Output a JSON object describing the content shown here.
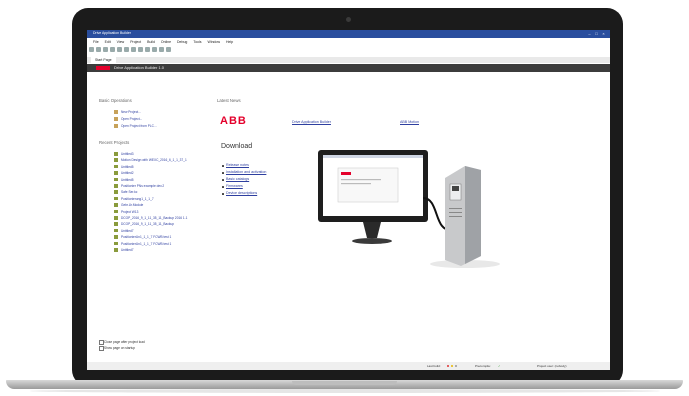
{
  "window": {
    "title": "Drive Application Builder"
  },
  "menu": [
    "File",
    "Edit",
    "View",
    "Project",
    "Build",
    "Online",
    "Debug",
    "Tools",
    "Window",
    "Help"
  ],
  "tab": {
    "label": "Start Page"
  },
  "app_header": {
    "title": "Drive Application Builder 1.0"
  },
  "basic_operations": {
    "heading": "Basic Operations",
    "items": [
      "New Project...",
      "Open Project...",
      "Open Project from PLC..."
    ]
  },
  "recent_projects": {
    "heading": "Recent Projects",
    "items": [
      "Untitled3",
      "Motion Design with WEXC_2016_6_1_1_37_1",
      "Untitled5",
      "Untitled2",
      "Untitled5",
      "Positionier PNs example dev.2",
      "Safe Ser.kc",
      "Positionierung1_1_1_7",
      "Gebr.Ur.Module",
      "Project W13",
      "DCOP_2016_9_1_11_35_11_Backup 2016 1.1",
      "DCOP_2016_9_1_11_35_11_Backup",
      "Untitled7",
      "PositionierUn1_1_1_7 FCWB test 1",
      "PositionierUn1_1_1_7 FCWB test 1",
      "Untitled7"
    ]
  },
  "latest_news": {
    "heading": "Latest News",
    "logo": "ABB",
    "links": [
      "Drive Application Builder",
      "ABB Motion"
    ]
  },
  "download": {
    "heading": "Download",
    "items": [
      "Release notes",
      "Installation and activation",
      "Basic catalogs",
      "Firmwares",
      "Device descriptions"
    ]
  },
  "options": {
    "close_after_load": "Close page after project load",
    "show_on_startup": "Show page on startup"
  },
  "statusbar": {
    "last_build": "Last build:",
    "precompile": "Precompile:",
    "project_user": "Project user: (nobody)"
  },
  "colors": {
    "accent": "#e4002b",
    "titlebar": "#2a4e9e",
    "link": "#2e3fa0"
  }
}
